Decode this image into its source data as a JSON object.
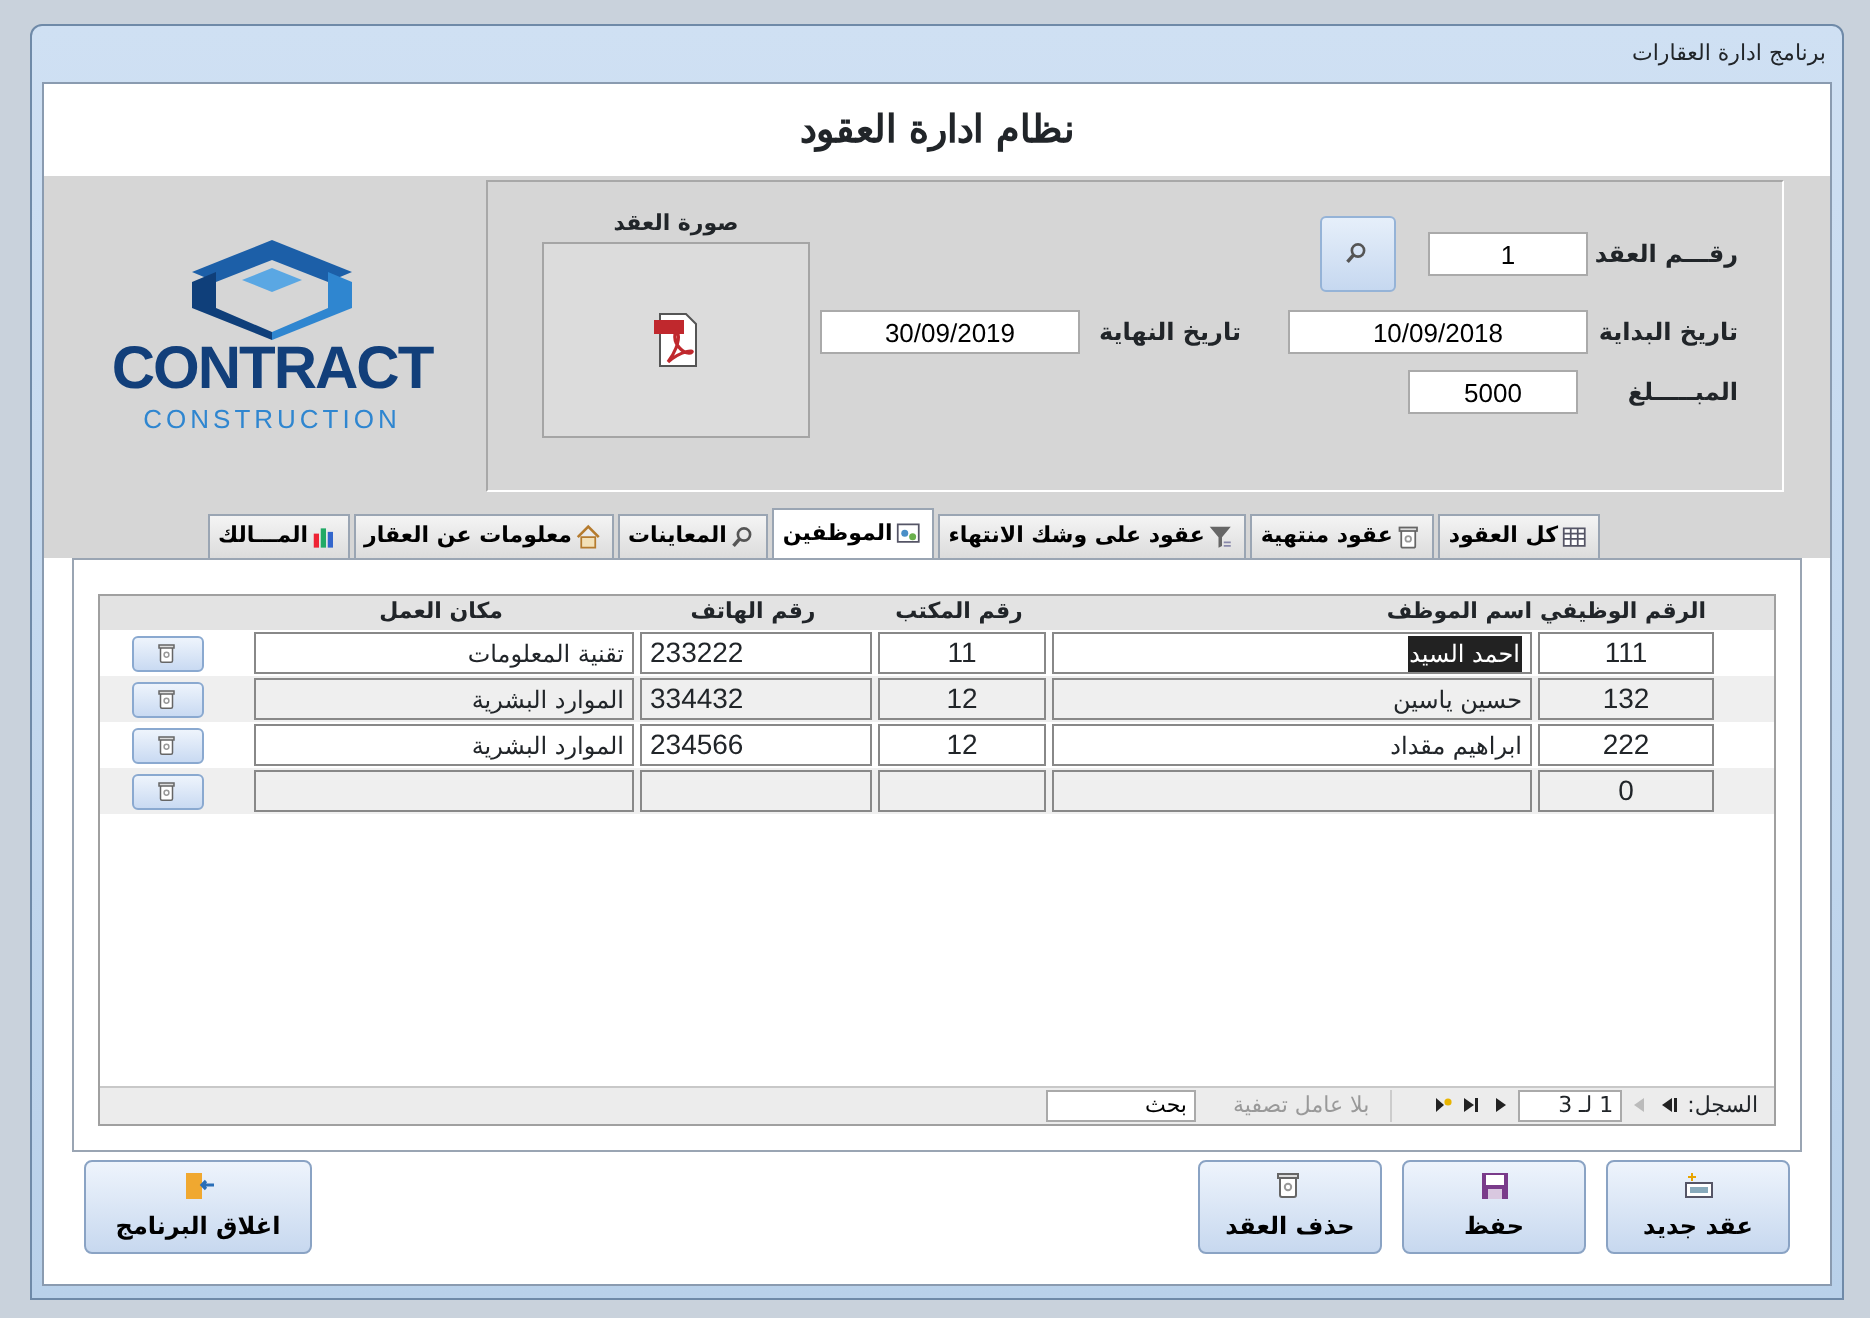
{
  "window": {
    "title": "برنامج ادارة العقارات"
  },
  "header": {
    "title": "نظام ادارة العقود"
  },
  "contract": {
    "number": {
      "label": "رقـــم العقد",
      "value": "1"
    },
    "start": {
      "label": "تاريخ البداية",
      "value": "10/09/2018"
    },
    "end": {
      "label": "تاريخ النهاية",
      "value": "30/09/2019"
    },
    "amount": {
      "label": "المبـــــلغ",
      "value": "5000"
    },
    "image_label": "صورة العقد"
  },
  "logo": {
    "name": "CONTRACT",
    "tagline": "CONSTRUCTION"
  },
  "tabs": [
    {
      "label": "كل العقود",
      "selected": false
    },
    {
      "label": "عقود منتهية",
      "selected": false
    },
    {
      "label": "عقود على وشك الانتهاء",
      "selected": false
    },
    {
      "label": "الموظفين",
      "selected": true
    },
    {
      "label": "المعاينات",
      "selected": false
    },
    {
      "label": "معلومات عن العقار",
      "selected": false
    },
    {
      "label": "المـــالك",
      "selected": false
    }
  ],
  "table": {
    "columns": [
      "الرقم الوظيفي",
      "اسم الموظف",
      "رقم المكتب",
      "رقم الهاتف",
      "مكان العمل"
    ],
    "rows": [
      {
        "id": "111",
        "name": "احمد السيد",
        "office": "11",
        "phone": "233222",
        "workplace": "تقنية المعلومات",
        "name_highlighted": true
      },
      {
        "id": "132",
        "name": "حسين ياسين",
        "office": "12",
        "phone": "334432",
        "workplace": "الموارد البشرية",
        "name_highlighted": false
      },
      {
        "id": "222",
        "name": "ابراهيم مقداد",
        "office": "12",
        "phone": "234566",
        "workplace": "الموارد البشرية",
        "name_highlighted": false
      },
      {
        "id": "0",
        "name_highlighted": false
      }
    ]
  },
  "record_nav": {
    "label": "السجل:",
    "position": "1 لـ 3",
    "filter": "بلا عامل تصفية",
    "search": "بحث"
  },
  "buttons": [
    {
      "label": "عقد جديد"
    },
    {
      "label": "حفظ"
    },
    {
      "label": "حذف العقد"
    },
    {
      "label": "اغلاق البرنامج"
    }
  ]
}
